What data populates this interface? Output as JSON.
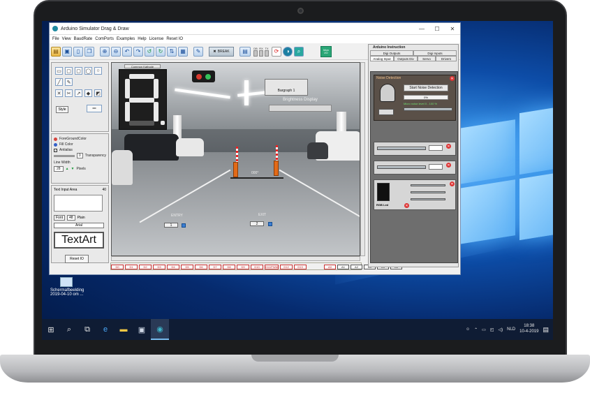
{
  "window": {
    "title": "Arduino Simulator Drag & Draw",
    "controls": [
      "—",
      "☐",
      "✕"
    ]
  },
  "menu": [
    "File",
    "View",
    "BaudRate",
    "ComPorts",
    "Examples",
    "Help",
    "License",
    "Reset IO"
  ],
  "toolbar": {
    "break_label": "BREAK",
    "led_labels": [
      "DB",
      "RX",
      "TX"
    ],
    "monitor_label": "Mon I/O"
  },
  "left_panel": {
    "style_label": "Style",
    "foreground_label": "ForeGroundColor",
    "fill_label": "Fill Color",
    "antialias_label": "Antialias",
    "transparency_label": "Transparency",
    "transparency_value": "0",
    "line_width_label": "Line Width",
    "line_width_value": "28",
    "pixels_label": "Pixels",
    "text_input_label": "Text Input Area",
    "text_input_count": "40",
    "font_label": "Font",
    "font_size": "48",
    "font_style": "Plain",
    "font_name": "Arial",
    "textart_label": "TextArt",
    "reset_label": "Reset IO"
  },
  "canvas": {
    "seg7_label": "Common Kathode",
    "bargraph_label": "Bargraph 1",
    "brightness_label": "Brightness Display",
    "gate_angle": "000°",
    "entry_label": "ENTRY",
    "exit_label": "EXIT",
    "entry_count": "1",
    "exit_count": "2"
  },
  "pins": {
    "digital": [
      "D0",
      "D1",
      "D2",
      "D3",
      "D4",
      "D5",
      "D6",
      "D7",
      "D8",
      "D9",
      "D10",
      "D11/PWM",
      "D12",
      "D13"
    ],
    "analog": [
      "A0",
      "A1",
      "A2",
      "A3",
      "A4",
      "A5"
    ]
  },
  "right_panel": {
    "title": "Arduino Instruction",
    "tabs_row1": [
      "Digi Outputs",
      "Digi Inputs"
    ],
    "tabs_row2": [
      "Analog Input",
      "Outputs Div",
      "Servo",
      "Drivers"
    ],
    "noise_title": "Noise Detection",
    "noise_button": "Start Noise Detection",
    "noise_percent": "0%",
    "noise_level": "Micro noise level 0 - 100 %",
    "rgb_label": "RGB Led"
  },
  "desktop": {
    "icon_label_1": "Schermafbeelding",
    "icon_label_2": "2019-04-10 om ..."
  },
  "taskbar": {
    "time": "18:38",
    "date": "10-4-2019",
    "language": "NLD"
  },
  "colors": {
    "accent": "#1f8aa0",
    "taskbar": "#0f1c34",
    "pin_border": "#cc3333"
  }
}
